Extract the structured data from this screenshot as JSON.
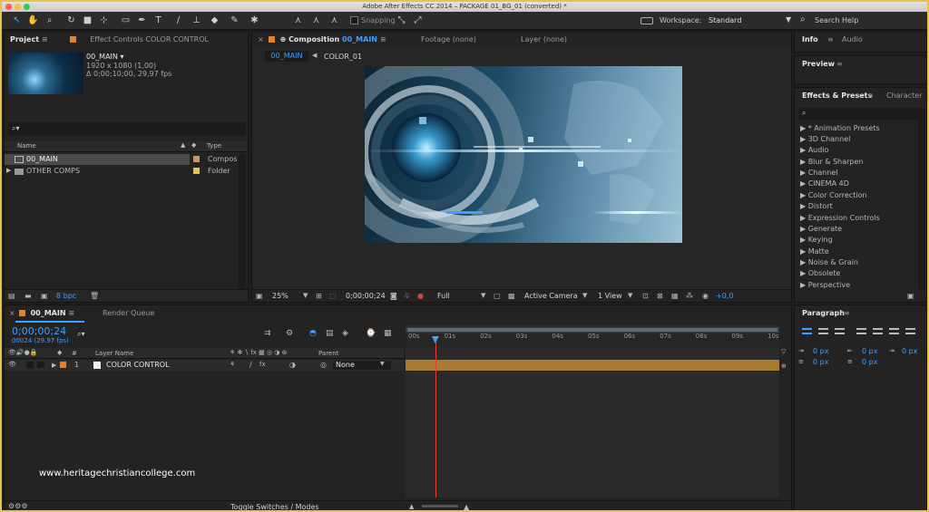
{
  "window": {
    "title": "Adobe After Effects CC 2014 – PACKAGE 01_BG_01 (converted) *"
  },
  "toolbar": {
    "snapping_label": "Snapping",
    "workspace_label": "Workspace:",
    "workspace_value": "Standard",
    "search_placeholder": "Search Help"
  },
  "project": {
    "tab_label": "Project",
    "effect_controls_tab": "Effect Controls COLOR CONTROL",
    "selected_name": "00_MAIN ▾",
    "selected_res": "1920 x 1080 (1,00)",
    "selected_dur": "Δ 0;00;10;00, 29,97 fps",
    "search_glyph": "⌕▾",
    "col_name": "Name",
    "col_type": "Type",
    "items": [
      {
        "name": "00_MAIN",
        "type": "Compos",
        "color": "#c49a60",
        "selected": true
      },
      {
        "name": "OTHER COMPS",
        "type": "Folder",
        "color": "#e0c840",
        "selected": false
      }
    ],
    "bpc": "8 bpc"
  },
  "composition": {
    "tab_label": "Composition",
    "tab_comp_name": "00_MAIN",
    "footage_tab": "Footage (none)",
    "layer_tab": "Layer (none)",
    "crumb_1": "00_MAIN",
    "crumb_2": "COLOR_01",
    "zoom": "25%",
    "timecode": "0;00;00;24",
    "resolution": "Full",
    "camera": "Active Camera",
    "views": "1 View",
    "exposure": "+0,0"
  },
  "right_panels": {
    "info_tab": "Info",
    "audio_tab": "Audio",
    "preview_tab": "Preview",
    "effects_tab": "Effects & Presets",
    "character_tab": "Character",
    "effects_list": [
      "▶ * Animation Presets",
      "▶ 3D Channel",
      "▶ Audio",
      "▶ Blur & Sharpen",
      "▶ Channel",
      "▶ CINEMA 4D",
      "▶ Color Correction",
      "▶ Distort",
      "▶ Expression Controls",
      "▶ Generate",
      "▶ Keying",
      "▶ Matte",
      "▶ Noise & Grain",
      "▶ Obsolete",
      "▶ Perspective"
    ],
    "paragraph_tab": "Paragraph",
    "para_values": [
      "0 px",
      "0 px",
      "0 px",
      "0 px",
      "0 px"
    ]
  },
  "timeline": {
    "comp_tab": "00_MAIN",
    "render_tab": "Render Queue",
    "timecode": "0;00;00;24",
    "frames": "00024 (29.97 fps)",
    "col_layer_name": "Layer Name",
    "col_hash": "#",
    "col_parent": "Parent",
    "layer": {
      "number": "1",
      "name": "COLOR CONTROL",
      "parent": "None"
    },
    "ruler": [
      "00s",
      "01s",
      "02s",
      "03s",
      "04s",
      "05s",
      "06s",
      "07s",
      "08s",
      "09s",
      "10s"
    ],
    "toggle_label": "Toggle Switches / Modes",
    "playhead_fraction": 0.08
  },
  "watermark": "www.heritagechristiancollege.com",
  "colors": {
    "accent": "#3ea0ff",
    "frame": "#e8c24a",
    "layer_bar": "#a87a34",
    "label_orange": "#e0822e"
  }
}
